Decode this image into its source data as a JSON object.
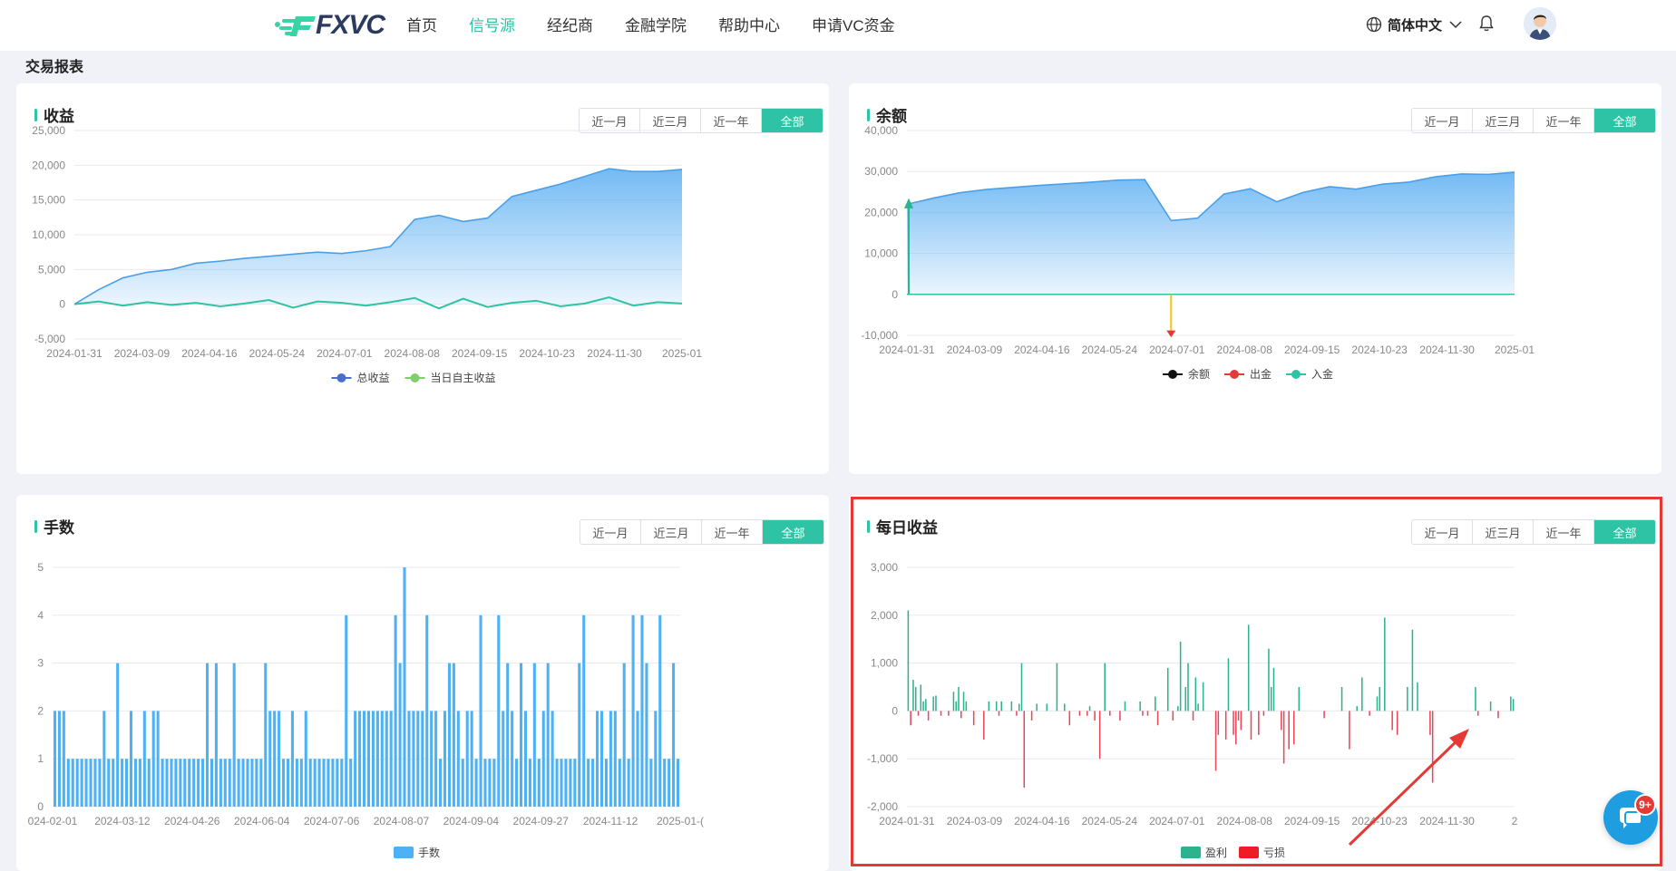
{
  "header": {
    "logo_text": "FXVC",
    "nav": [
      {
        "label": "首页",
        "active": false
      },
      {
        "label": "信号源",
        "active": true
      },
      {
        "label": "经纪商",
        "active": false
      },
      {
        "label": "金融学院",
        "active": false
      },
      {
        "label": "帮助中心",
        "active": false
      },
      {
        "label": "申请VC资金",
        "active": false
      }
    ],
    "language": "简体中文"
  },
  "section_title": "交易报表",
  "range_options": [
    "近一月",
    "近三月",
    "近一年",
    "全部"
  ],
  "range_selected": "全部",
  "colors": {
    "accent": "#2ec3a5",
    "area": "#5aaef2",
    "bar": "#4db1f5",
    "profit": "#2bb38e",
    "loss": "#e8475a"
  },
  "chat_badge": "9+",
  "chart_data": [
    {
      "id": "earnings",
      "type": "area",
      "title": "收益",
      "ylim": [
        -5000,
        25000
      ],
      "yticks": [
        "25,000",
        "20,000",
        "15,000",
        "10,000",
        "5,000",
        "0",
        "-5,000"
      ],
      "xticks": [
        "2024-01-31",
        "2024-03-09",
        "2024-04-16",
        "2024-05-24",
        "2024-07-01",
        "2024-08-08",
        "2024-09-15",
        "2024-10-23",
        "2024-11-30",
        "2025-01"
      ],
      "legend": [
        "总收益",
        "当日自主收益"
      ],
      "series": [
        {
          "name": "总收益",
          "values": [
            0,
            2100,
            3800,
            4600,
            5000,
            5900,
            6200,
            6600,
            6900,
            7200,
            7500,
            7300,
            7700,
            8300,
            12200,
            12800,
            11900,
            12400,
            15500,
            16400,
            17300,
            18400,
            19500,
            19100,
            19100,
            19400
          ]
        },
        {
          "name": "当日自主收益",
          "values": [
            0,
            400,
            -200,
            300,
            -100,
            200,
            -300,
            100,
            600,
            -500,
            400,
            200,
            -200,
            300,
            900,
            -600,
            800,
            -400,
            200,
            500,
            -300,
            100,
            1000,
            -200,
            300,
            100
          ]
        }
      ]
    },
    {
      "id": "balance",
      "type": "area",
      "title": "余额",
      "ylim": [
        -10000,
        40000
      ],
      "yticks": [
        "40,000",
        "30,000",
        "20,000",
        "10,000",
        "0",
        "-10,000"
      ],
      "xticks": [
        "2024-01-31",
        "2024-03-09",
        "2024-04-16",
        "2024-05-24",
        "2024-07-01",
        "2024-08-08",
        "2024-09-15",
        "2024-10-23",
        "2024-11-30",
        "2025-01"
      ],
      "legend": [
        "余额",
        "出金",
        "入金"
      ],
      "series": [
        {
          "name": "余额",
          "values": [
            22000,
            23500,
            24800,
            25600,
            26100,
            26600,
            27000,
            27400,
            27900,
            28000,
            18000,
            18600,
            24500,
            25800,
            22600,
            24900,
            26300,
            25700,
            26900,
            27400,
            28700,
            29400,
            29300,
            29800
          ]
        }
      ]
    },
    {
      "id": "lots",
      "type": "bar",
      "title": "手数",
      "ylim": [
        0,
        5
      ],
      "yticks": [
        "5",
        "4",
        "3",
        "2",
        "1",
        "0"
      ],
      "xticks": [
        "024-02-01",
        "2024-03-12",
        "2024-04-26",
        "2024-06-04",
        "2024-07-06",
        "2024-08-07",
        "2024-09-04",
        "2024-09-27",
        "2024-11-12",
        "2025-01-("
      ],
      "legend": [
        "手数"
      ],
      "values": [
        2,
        2,
        2,
        1,
        1,
        1,
        1,
        1,
        1,
        1,
        1,
        2,
        1,
        1,
        3,
        1,
        1,
        2,
        1,
        1,
        2,
        1,
        2,
        2,
        1,
        1,
        1,
        1,
        1,
        1,
        1,
        1,
        1,
        1,
        3,
        1,
        3,
        1,
        1,
        1,
        3,
        1,
        1,
        1,
        1,
        1,
        1,
        3,
        2,
        2,
        2,
        1,
        1,
        2,
        1,
        1,
        2,
        1,
        1,
        1,
        1,
        1,
        1,
        1,
        1,
        4,
        1,
        2,
        2,
        2,
        2,
        2,
        2,
        2,
        2,
        2,
        4,
        3,
        5,
        2,
        2,
        2,
        2,
        4,
        2,
        2,
        1,
        2,
        3,
        3,
        2,
        1,
        2,
        2,
        1,
        4,
        1,
        1,
        1,
        4,
        2,
        3,
        2,
        1,
        3,
        2,
        1,
        3,
        1,
        2,
        3,
        2,
        1,
        1,
        1,
        1,
        1,
        3,
        4,
        1,
        1,
        2,
        2,
        1,
        2,
        2,
        1,
        3,
        1,
        4,
        2,
        4,
        3,
        1,
        2,
        4,
        1,
        1,
        3,
        1
      ]
    },
    {
      "id": "daily",
      "type": "bar",
      "title": "每日收益",
      "ylim": [
        -2000,
        3000
      ],
      "yticks": [
        "3,000",
        "2,000",
        "1,000",
        "0",
        "-1,000",
        "-2,000"
      ],
      "xticks": [
        "2024-01-31",
        "2024-03-09",
        "2024-04-16",
        "2024-05-24",
        "2024-07-01",
        "2024-08-08",
        "2024-09-15",
        "2024-10-23",
        "2024-11-30",
        "2"
      ],
      "legend": [
        "盈利",
        "亏损"
      ],
      "values": [
        2100,
        -300,
        650,
        500,
        -100,
        550,
        200,
        250,
        -200,
        0,
        300,
        320,
        0,
        -100,
        0,
        0,
        -100,
        0,
        400,
        200,
        500,
        -150,
        400,
        200,
        0,
        0,
        -300,
        0,
        0,
        0,
        -600,
        0,
        200,
        0,
        0,
        200,
        -100,
        200,
        0,
        0,
        0,
        200,
        0,
        -100,
        150,
        1000,
        -1600,
        0,
        0,
        -200,
        0,
        150,
        0,
        0,
        0,
        150,
        0,
        0,
        0,
        1000,
        0,
        0,
        150,
        0,
        -300,
        0,
        0,
        0,
        -100,
        0,
        0,
        -100,
        100,
        0,
        -200,
        0,
        -1000,
        0,
        1000,
        0,
        -100,
        0,
        0,
        0,
        -200,
        0,
        200,
        0,
        0,
        0,
        0,
        0,
        200,
        -100,
        0,
        -100,
        0,
        0,
        300,
        -300,
        0,
        0,
        0,
        900,
        0,
        -200,
        0,
        100,
        1450,
        0,
        500,
        1000,
        0,
        -200,
        700,
        150,
        0,
        600,
        0,
        0,
        0,
        0,
        -1250,
        -500,
        0,
        0,
        -600,
        1100,
        0,
        -500,
        -700,
        -200,
        -400,
        0,
        0,
        1800,
        -600,
        0,
        0,
        -500,
        0,
        -100,
        0,
        1300,
        500,
        900,
        0,
        0,
        -400,
        -1100,
        0,
        -800,
        0,
        -700,
        0,
        500,
        0,
        0,
        0,
        0,
        0,
        0,
        0,
        0,
        0,
        -150,
        0,
        0,
        0,
        0,
        0,
        0,
        500,
        0,
        0,
        -800,
        0,
        0,
        100,
        0,
        700,
        0,
        0,
        -100,
        0,
        0,
        300,
        500,
        0,
        1950,
        0,
        0,
        -400,
        0,
        -500,
        0,
        0,
        0,
        500,
        0,
        1700,
        0,
        600,
        0,
        0,
        0,
        0,
        -500,
        -1500,
        0,
        0,
        0,
        0,
        0,
        0,
        0,
        0,
        0,
        0,
        0,
        0,
        0,
        0,
        0,
        0,
        500,
        -100,
        0,
        0,
        0,
        0,
        200,
        0,
        0,
        -150,
        0,
        0,
        0,
        0,
        300,
        250
      ]
    }
  ]
}
